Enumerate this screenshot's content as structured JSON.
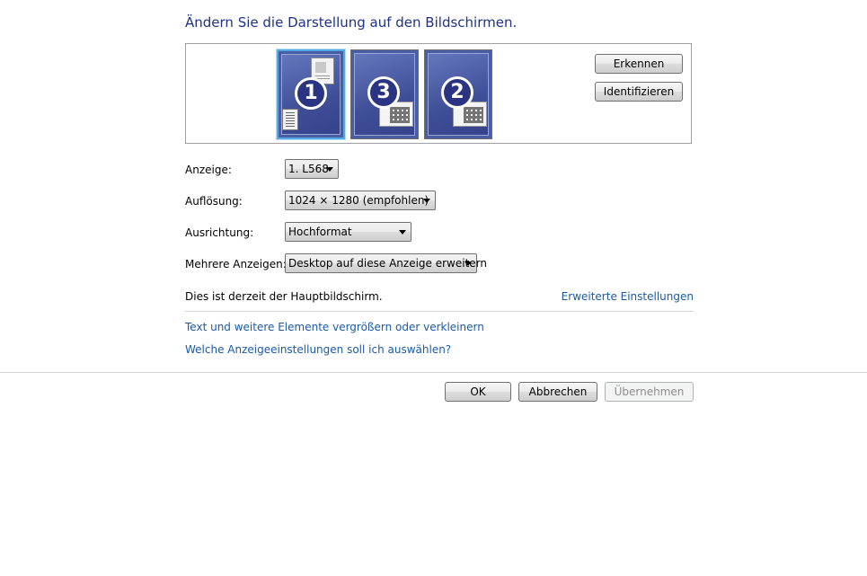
{
  "heading": "Ändern Sie die Darstellung auf den Bildschirmen.",
  "monitors": [
    {
      "number": "1",
      "selected": true
    },
    {
      "number": "3",
      "selected": false
    },
    {
      "number": "2",
      "selected": false
    }
  ],
  "buttons": {
    "detect": "Erkennen",
    "identify": "Identifizieren",
    "ok": "OK",
    "cancel": "Abbrechen",
    "apply": "Übernehmen"
  },
  "fields": {
    "display": {
      "label": "Anzeige:",
      "value": "1. L568"
    },
    "resolution": {
      "label": "Auflösung:",
      "value": "1024 × 1280 (empfohlen)"
    },
    "orientation": {
      "label": "Ausrichtung:",
      "value": "Hochformat"
    },
    "multiple": {
      "label": "Mehrere Anzeigen:",
      "value": "Desktop auf diese Anzeige erweitern"
    }
  },
  "status": "Dies ist derzeit der Hauptbildschirm.",
  "links": {
    "advanced": "Erweiterte Einstellungen",
    "text_size": "Text und weitere Elemente vergrößern oder verkleinern",
    "help": "Welche Anzeigeeinstellungen soll ich auswählen?"
  },
  "colors": {
    "heading": "#1e3287",
    "link": "#1a5aa5",
    "monitor_bg": "#4a5ea6"
  }
}
